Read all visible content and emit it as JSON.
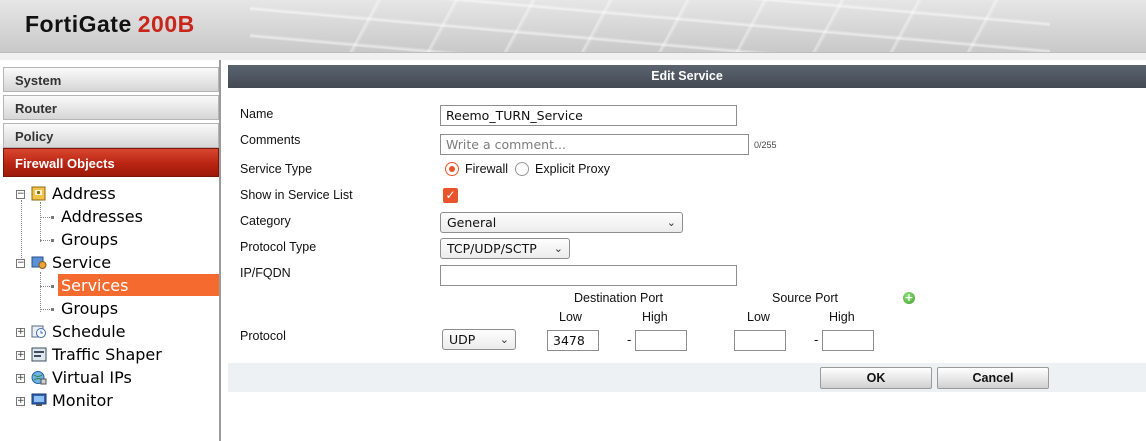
{
  "header": {
    "brand": "FortiGate",
    "model": "200B"
  },
  "sidebar": {
    "nav": [
      {
        "label": "System"
      },
      {
        "label": "Router"
      },
      {
        "label": "Policy"
      },
      {
        "label": "Firewall Objects",
        "active": true
      }
    ],
    "tree": {
      "address": {
        "label": "Address",
        "children": [
          "Addresses",
          "Groups"
        ]
      },
      "service": {
        "label": "Service",
        "children": [
          "Services",
          "Groups"
        ],
        "selected": "Services"
      },
      "schedule": {
        "label": "Schedule"
      },
      "traffic_shaper": {
        "label": "Traffic Shaper"
      },
      "virtual_ips": {
        "label": "Virtual IPs"
      },
      "monitor": {
        "label": "Monitor"
      }
    }
  },
  "form": {
    "title": "Edit Service",
    "name": {
      "label": "Name",
      "value": "Reemo_TURN_Service"
    },
    "comments": {
      "label": "Comments",
      "placeholder": "Write a comment...",
      "counter": "0/255"
    },
    "service_type": {
      "label": "Service Type",
      "options": [
        "Firewall",
        "Explicit Proxy"
      ],
      "selected": "Firewall"
    },
    "show_in_list": {
      "label": "Show in Service List",
      "checked": true
    },
    "category": {
      "label": "Category",
      "value": "General"
    },
    "protocol_type": {
      "label": "Protocol Type",
      "value": "TCP/UDP/SCTP"
    },
    "ip_fqdn": {
      "label": "IP/FQDN",
      "value": ""
    },
    "protocol": {
      "label": "Protocol",
      "destination_port_label": "Destination Port",
      "source_port_label": "Source Port",
      "low_label": "Low",
      "high_label": "High",
      "row": {
        "protocol": "UDP",
        "dst_low": "3478",
        "dst_high": "",
        "src_low": "",
        "src_high": ""
      },
      "separator": "-"
    },
    "buttons": {
      "ok": "OK",
      "cancel": "Cancel"
    }
  },
  "colors": {
    "accent": "#e8552a",
    "active_nav": "#b92412",
    "selected_leaf": "#f56a2f",
    "title_bar": "#4a515b",
    "brand_model": "#c8261b"
  },
  "icons": [
    "address-book-icon",
    "service-icon",
    "schedule-clock-icon",
    "traffic-shaper-icon",
    "virtual-ip-globe-icon",
    "monitor-icon",
    "add-row-icon"
  ]
}
